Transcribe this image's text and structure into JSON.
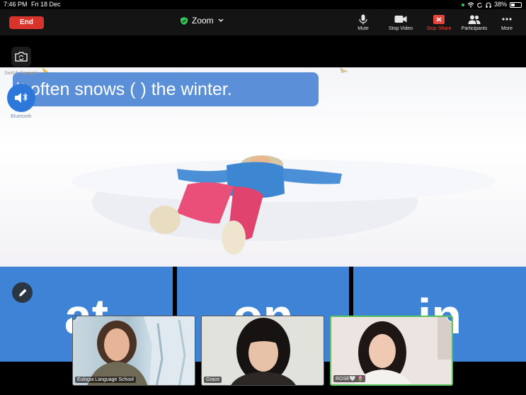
{
  "status_bar": {
    "time": "7:46 PM",
    "date": "Fri 18 Dec",
    "battery": "38%",
    "battery_level": 0.38
  },
  "toolbar": {
    "end_label": "End",
    "meeting_title": "Zoom",
    "items": [
      {
        "label": "Mute",
        "icon": "microphone-icon"
      },
      {
        "label": "Stop Video",
        "icon": "video-camera-icon"
      },
      {
        "label": "Stop Share",
        "icon": "stop-share-icon"
      },
      {
        "label": "Participants",
        "icon": "participants-icon"
      },
      {
        "label": "More",
        "icon": "more-dots-icon"
      }
    ]
  },
  "controls": {
    "switch_camera_label": "Switch Camera",
    "audio_label": "Bluetooth"
  },
  "slide": {
    "sentence": "It often snows  (      ) the winter.",
    "options": [
      "at",
      "on",
      "in"
    ]
  },
  "participants": [
    {
      "name": "Eulogia Language School"
    },
    {
      "name": "Grace"
    },
    {
      "name": "ROSE🤍 🌷"
    }
  ],
  "colors": {
    "accent_blue": "#3f83d6",
    "end_red": "#d9342b",
    "active_speaker": "#57c35a"
  }
}
